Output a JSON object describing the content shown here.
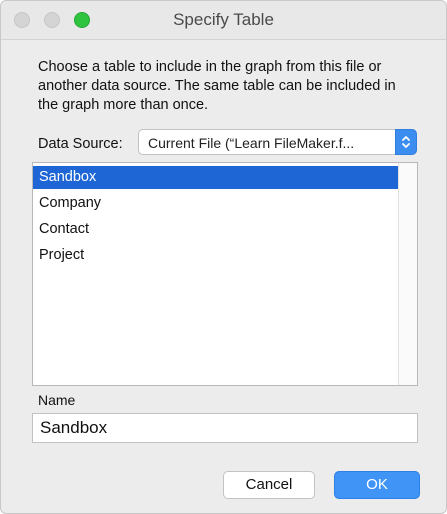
{
  "window": {
    "title": "Specify Table"
  },
  "description": "Choose a table to include in the graph from this file or another data source.  The same table can be included in the graph more than once.",
  "data_source": {
    "label": "Data Source:",
    "selected": "Current File (“Learn FileMaker.f..."
  },
  "tables": [
    {
      "label": "Sandbox",
      "selected": true
    },
    {
      "label": "Company",
      "selected": false
    },
    {
      "label": "Contact",
      "selected": false
    },
    {
      "label": "Project",
      "selected": false
    }
  ],
  "name_field": {
    "label": "Name",
    "value": "Sandbox"
  },
  "buttons": {
    "cancel": "Cancel",
    "ok": "OK"
  },
  "colors": {
    "accent": "#1e66d6",
    "button_primary": "#3f94f5",
    "zoom_green": "#2fc440"
  }
}
